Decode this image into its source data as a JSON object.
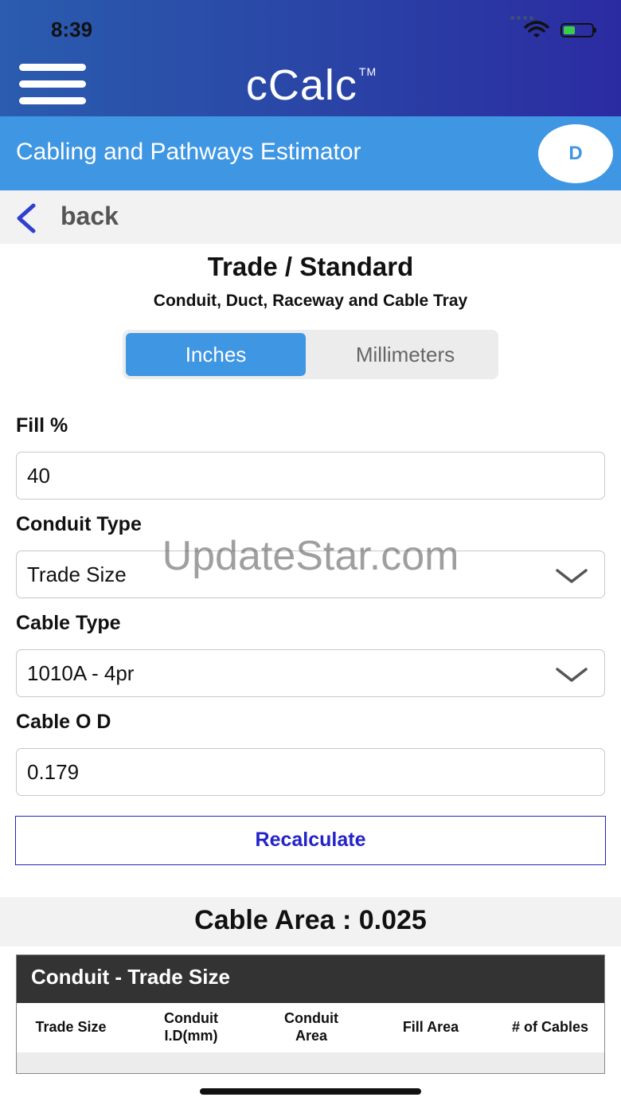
{
  "status_bar": {
    "time": "8:39"
  },
  "header": {
    "app_name": "cCalc",
    "trademark": "TM"
  },
  "subheader": {
    "title": "Cabling and Pathways Estimator",
    "avatar_initial": "D"
  },
  "nav": {
    "back_label": "back"
  },
  "section": {
    "title": "Trade / Standard",
    "subtitle": "Conduit, Duct, Raceway and Cable Tray"
  },
  "units_toggle": {
    "options": [
      "Inches",
      "Millimeters"
    ],
    "selected": "Inches"
  },
  "form": {
    "fill": {
      "label": "Fill %",
      "value": "40"
    },
    "conduit_type": {
      "label": "Conduit Type",
      "value": "Trade Size"
    },
    "cable_type": {
      "label": "Cable Type",
      "value": "1010A - 4pr"
    },
    "cable_od": {
      "label": "Cable O D",
      "value": "0.179"
    }
  },
  "actions": {
    "recalculate_label": "Recalculate"
  },
  "result": {
    "cable_area_text": "Cable Area :  0.025"
  },
  "table": {
    "title": "Conduit - Trade Size",
    "columns": [
      "Trade Size",
      "Conduit\nI.D(mm)",
      "Conduit\nArea",
      "Fill Area",
      "# of Cables"
    ]
  },
  "watermark": "UpdateStar.com",
  "colors": {
    "header_blue": "#2a48a7",
    "subheader_blue": "#3f96e3",
    "button_text": "#2323c8",
    "table_header": "#333333"
  }
}
